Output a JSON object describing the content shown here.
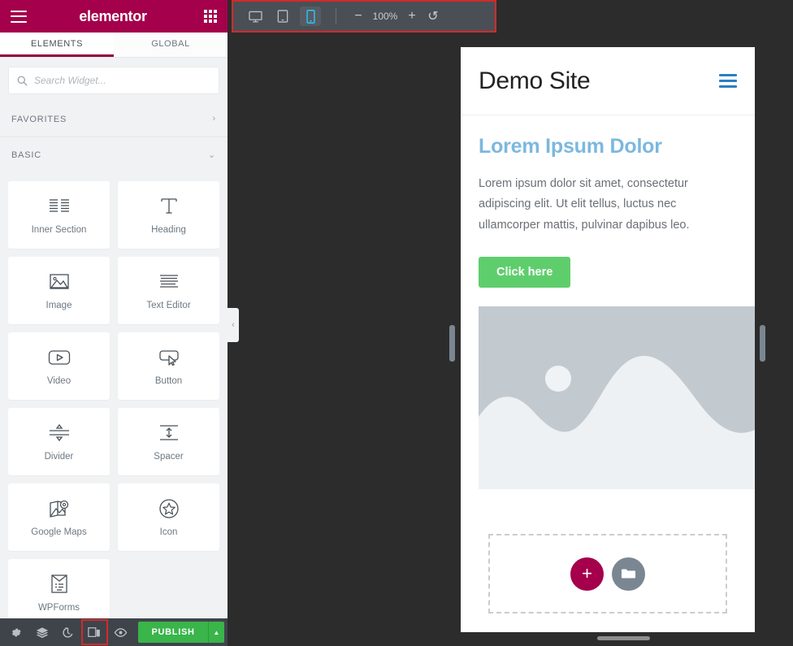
{
  "panel": {
    "brand": "elementor",
    "menu_icon": "hamburger-icon",
    "apps_icon": "grid-apps-icon",
    "tabs": [
      {
        "label": "ELEMENTS",
        "active": true
      },
      {
        "label": "GLOBAL",
        "active": false
      }
    ],
    "search": {
      "placeholder": "Search Widget...",
      "value": ""
    },
    "categories": [
      {
        "label": "FAVORITES",
        "expanded": false,
        "chevron": "›"
      },
      {
        "label": "BASIC",
        "expanded": true,
        "chevron": "⌄"
      }
    ],
    "widgets": [
      {
        "label": "Inner Section",
        "icon": "inner-section-icon"
      },
      {
        "label": "Heading",
        "icon": "heading-t-icon"
      },
      {
        "label": "Image",
        "icon": "image-icon"
      },
      {
        "label": "Text Editor",
        "icon": "text-editor-icon"
      },
      {
        "label": "Video",
        "icon": "video-play-icon"
      },
      {
        "label": "Button",
        "icon": "button-cursor-icon"
      },
      {
        "label": "Divider",
        "icon": "divider-icon"
      },
      {
        "label": "Spacer",
        "icon": "spacer-icon"
      },
      {
        "label": "Google Maps",
        "icon": "google-maps-pin-icon"
      },
      {
        "label": "Icon",
        "icon": "star-circle-icon"
      },
      {
        "label": "WPForms",
        "icon": "wpforms-icon"
      }
    ],
    "collapse_handle": "‹"
  },
  "footer": {
    "buttons": [
      {
        "name": "settings",
        "icon": "gear-icon",
        "highlighted": false
      },
      {
        "name": "navigator",
        "icon": "layers-icon",
        "highlighted": false
      },
      {
        "name": "history",
        "icon": "history-clock-icon",
        "highlighted": false
      },
      {
        "name": "responsive-mode",
        "icon": "responsive-mode-icon",
        "highlighted": true
      },
      {
        "name": "preview",
        "icon": "eye-icon",
        "highlighted": false
      }
    ],
    "publish_label": "PUBLISH",
    "publish_arrow": "▲"
  },
  "toolbar": {
    "devices": [
      {
        "name": "desktop",
        "icon": "desktop-icon",
        "active": false
      },
      {
        "name": "tablet",
        "icon": "tablet-icon",
        "active": false
      },
      {
        "name": "mobile",
        "icon": "mobile-icon",
        "active": true
      }
    ],
    "zoom_out": "−",
    "zoom_value": "100%",
    "zoom_in": "+",
    "reset": "↺",
    "highlighted": true
  },
  "preview": {
    "site_title": "Demo Site",
    "menu_icon": "site-hamburger-icon",
    "heading": "Lorem Ipsum Dolor",
    "paragraph": "Lorem ipsum dolor sit amet, consectetur adipiscing elit. Ut elit tellus, luctus nec ullamcorper mattis, pulvinar dapibus leo.",
    "button_label": "Click here",
    "image_placeholder": "landscape-image-placeholder",
    "add_section_icon": "plus-icon",
    "template_library_icon": "folder-icon"
  },
  "colors": {
    "brand_crimson": "#a4004b",
    "tab_underline": "#93003f",
    "publish_green": "#39b54a",
    "site_button_green": "#5ece6c",
    "site_heading_blue": "#7cb8e0",
    "device_active_blue": "#2fc3f7",
    "highlight_red": "#d32a2a",
    "panel_bg": "#f1f2f3",
    "editor_bg": "#2c2c2c"
  }
}
